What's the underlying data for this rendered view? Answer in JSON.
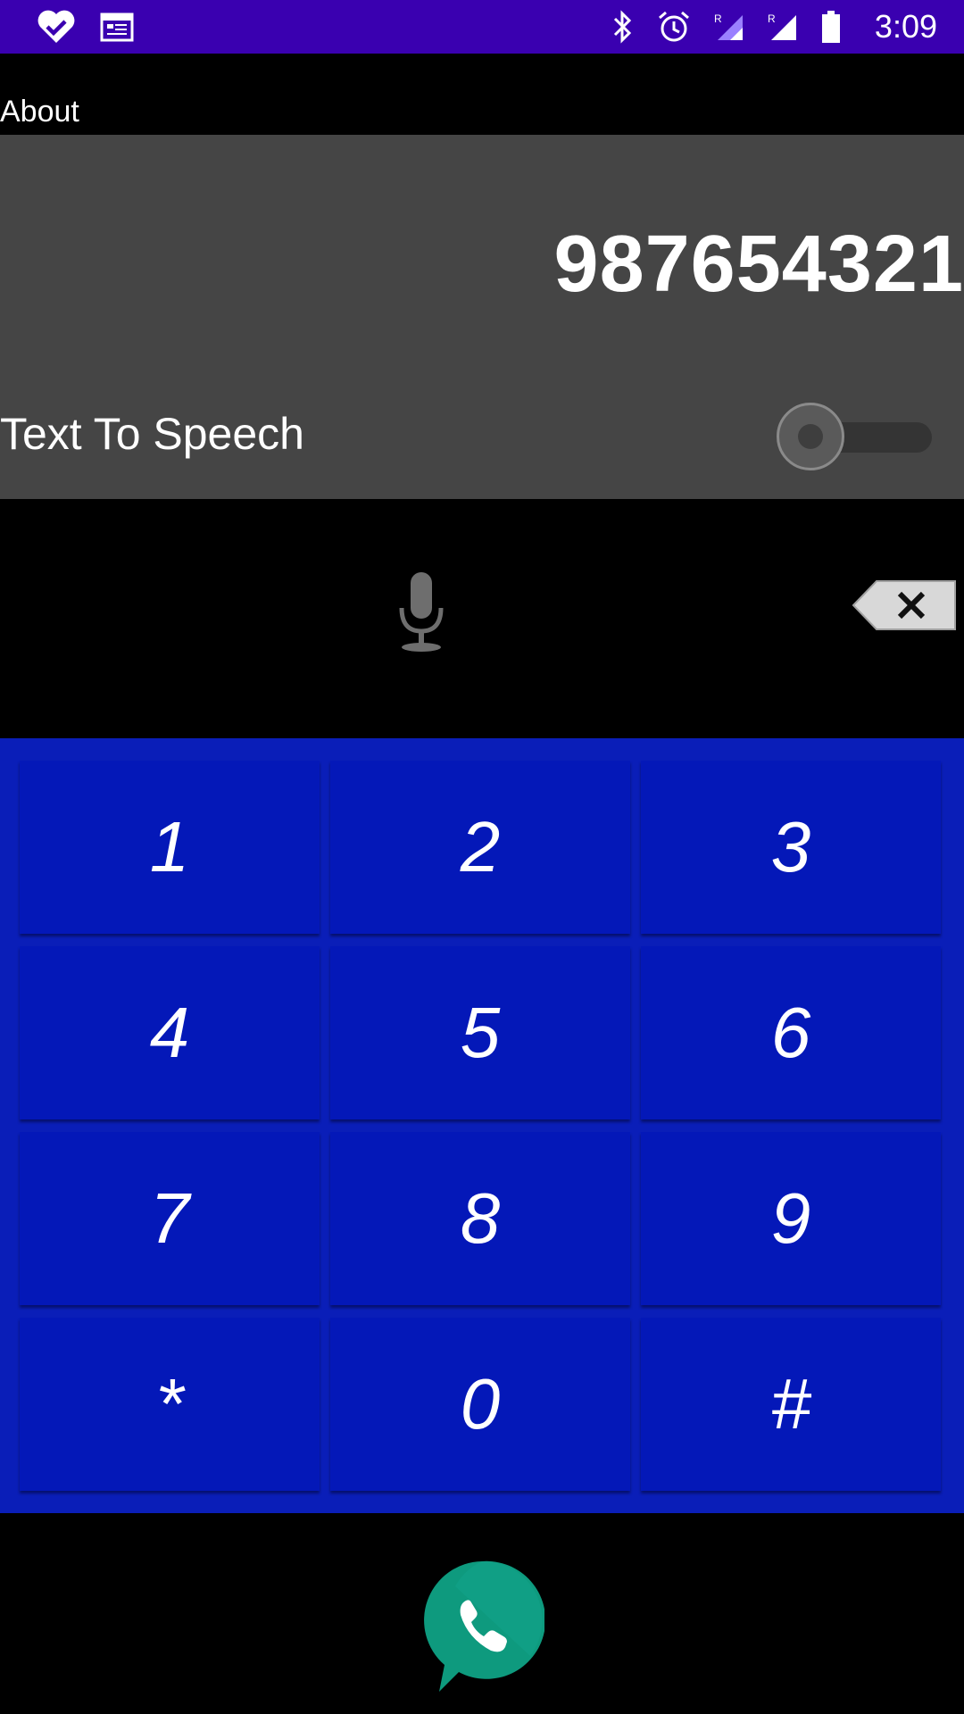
{
  "status_bar": {
    "time": "3:09",
    "icons": [
      "heart-check-icon",
      "calendar-icon",
      "bluetooth-icon",
      "alarm-icon",
      "signal-roaming-icon",
      "signal-roaming-icon",
      "battery-icon"
    ]
  },
  "menu": {
    "about_label": "About"
  },
  "display": {
    "number": "987654321",
    "tts_label": "Text To Speech",
    "tts_enabled": false
  },
  "actions": {
    "mic_icon": "microphone-icon",
    "backspace_icon": "backspace-icon"
  },
  "keypad": {
    "keys": [
      "1",
      "2",
      "3",
      "4",
      "5",
      "6",
      "7",
      "8",
      "9",
      "*",
      "0",
      "#"
    ]
  },
  "call": {
    "icon": "phone-icon"
  },
  "colors": {
    "status_bar": "#3a00b0",
    "display_bg": "#454545",
    "keypad_bg": "#0a1eb8",
    "key_bg": "#0418b8",
    "call_button": "#0e9a7e"
  }
}
